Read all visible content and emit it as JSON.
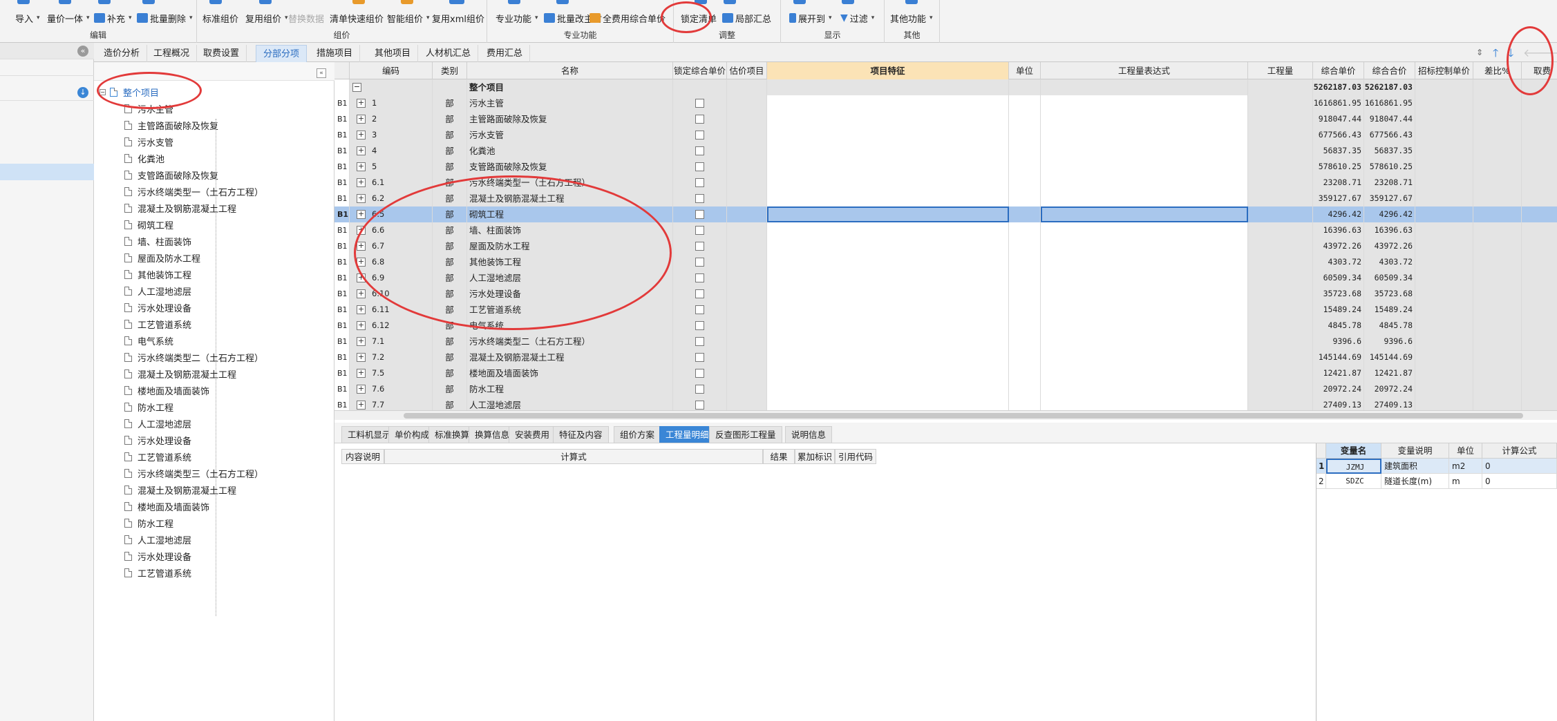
{
  "ribbon": {
    "groups": {
      "edit": "编辑",
      "pricing": "组价",
      "professional": "专业功能",
      "adjust": "调整",
      "display": "显示",
      "other": "其他"
    },
    "buttons": {
      "import": "导入",
      "price_integration": "量价一体",
      "supplement": "补充",
      "batch_delete": "批量删除",
      "standard_pricing": "标准组价",
      "reuse_pricing": "复用组价",
      "replace_data": "替换数据",
      "list_quick_pricing": "清单快速组价",
      "smart_pricing": "智能组价",
      "reuse_xml_pricing": "复用xml组价",
      "professional_func": "专业功能",
      "batch_change_material": "批量改主材",
      "full_cost_unit_price": "全费用综合单价",
      "lock_list": "锁定清单",
      "partial_summary": "局部汇总",
      "expand_to": "展开到",
      "filter": "过滤",
      "other_func": "其他功能"
    }
  },
  "tabs": [
    "造价分析",
    "工程概况",
    "取费设置",
    "分部分项",
    "措施项目",
    "其他项目",
    "人材机汇总",
    "费用汇总"
  ],
  "active_tab": "分部分项",
  "tree": {
    "root": "整个项目",
    "items": [
      "污水主管",
      "主管路面破除及恢复",
      "污水支管",
      "化粪池",
      "支管路面破除及恢复",
      "污水终端类型一（土石方工程）",
      "混凝土及钢筋混凝土工程",
      "砌筑工程",
      "墙、柱面装饰",
      "屋面及防水工程",
      "其他装饰工程",
      "人工湿地滤层",
      "污水处理设备",
      "工艺管道系统",
      "电气系统",
      "污水终端类型二（土石方工程）",
      "混凝土及钢筋混凝土工程",
      "楼地面及墙面装饰",
      "防水工程",
      "人工湿地滤层",
      "污水处理设备",
      "工艺管道系统",
      "污水终端类型三（土石方工程）",
      "混凝土及钢筋混凝土工程",
      "楼地面及墙面装饰",
      "防水工程",
      "人工湿地滤层",
      "污水处理设备",
      "工艺管道系统"
    ]
  },
  "grid": {
    "headers": {
      "code": "编码",
      "category": "类别",
      "name": "名称",
      "lock_unit_price": "锁定综合单价",
      "estimate_item": "估价项目",
      "item_feature": "项目特征",
      "unit": "单位",
      "quantity_expr": "工程量表达式",
      "quantity": "工程量",
      "unit_price": "综合单价",
      "total_price": "综合合价",
      "bid_control_price": "招标控制单价",
      "diff": "差比%",
      "fee": "取费"
    },
    "total_row": {
      "name": "整个项目",
      "unit_price": "5262187.03",
      "total_price": "5262187.03"
    },
    "rows": [
      {
        "rn": "B1",
        "code": "1",
        "cat": "部",
        "name": "污水主管",
        "up": "1616861.95",
        "tp": "1616861.95"
      },
      {
        "rn": "B1",
        "code": "2",
        "cat": "部",
        "name": "主管路面破除及恢复",
        "up": "918047.44",
        "tp": "918047.44"
      },
      {
        "rn": "B1",
        "code": "3",
        "cat": "部",
        "name": "污水支管",
        "up": "677566.43",
        "tp": "677566.43"
      },
      {
        "rn": "B1",
        "code": "4",
        "cat": "部",
        "name": "化粪池",
        "up": "56837.35",
        "tp": "56837.35"
      },
      {
        "rn": "B1",
        "code": "5",
        "cat": "部",
        "name": "支管路面破除及恢复",
        "up": "578610.25",
        "tp": "578610.25"
      },
      {
        "rn": "B1",
        "code": "6.1",
        "cat": "部",
        "name": "污水终端类型一（土石方工程）",
        "up": "23208.71",
        "tp": "23208.71"
      },
      {
        "rn": "B1",
        "code": "6.2",
        "cat": "部",
        "name": "混凝土及钢筋混凝土工程",
        "up": "359127.67",
        "tp": "359127.67"
      },
      {
        "rn": "B1",
        "code": "6.5",
        "cat": "部",
        "name": "砌筑工程",
        "up": "4296.42",
        "tp": "4296.42",
        "selected": true
      },
      {
        "rn": "B1",
        "code": "6.6",
        "cat": "部",
        "name": "墙、柱面装饰",
        "up": "16396.63",
        "tp": "16396.63"
      },
      {
        "rn": "B1",
        "code": "6.7",
        "cat": "部",
        "name": "屋面及防水工程",
        "up": "43972.26",
        "tp": "43972.26"
      },
      {
        "rn": "B1",
        "code": "6.8",
        "cat": "部",
        "name": "其他装饰工程",
        "up": "4303.72",
        "tp": "4303.72"
      },
      {
        "rn": "B1",
        "code": "6.9",
        "cat": "部",
        "name": "人工湿地滤层",
        "up": "60509.34",
        "tp": "60509.34"
      },
      {
        "rn": "B1",
        "code": "6.10",
        "cat": "部",
        "name": "污水处理设备",
        "up": "35723.68",
        "tp": "35723.68"
      },
      {
        "rn": "B1",
        "code": "6.11",
        "cat": "部",
        "name": "工艺管道系统",
        "up": "15489.24",
        "tp": "15489.24"
      },
      {
        "rn": "B1",
        "code": "6.12",
        "cat": "部",
        "name": "电气系统",
        "up": "4845.78",
        "tp": "4845.78"
      },
      {
        "rn": "B1",
        "code": "7.1",
        "cat": "部",
        "name": "污水终端类型二（土石方工程）",
        "up": "9396.6",
        "tp": "9396.6"
      },
      {
        "rn": "B1",
        "code": "7.2",
        "cat": "部",
        "name": "混凝土及钢筋混凝土工程",
        "up": "145144.69",
        "tp": "145144.69"
      },
      {
        "rn": "B1",
        "code": "7.5",
        "cat": "部",
        "name": "楼地面及墙面装饰",
        "up": "12421.87",
        "tp": "12421.87"
      },
      {
        "rn": "B1",
        "code": "7.6",
        "cat": "部",
        "name": "防水工程",
        "up": "20972.24",
        "tp": "20972.24"
      },
      {
        "rn": "B1",
        "code": "7.7",
        "cat": "部",
        "name": "人工湿地滤层",
        "up": "27409.13",
        "tp": "27409.13"
      }
    ]
  },
  "bottom_tabs": [
    "工料机显示",
    "单价构成",
    "标准换算",
    "换算信息",
    "安装费用",
    "特征及内容",
    "组价方案",
    "工程量明细",
    "反查图形工程量",
    "说明信息"
  ],
  "active_bottom_tab": "工程量明细",
  "detail_headers": [
    "内容说明",
    "计算式",
    "结果",
    "累加标识",
    "引用代码"
  ],
  "vars": {
    "headers": [
      "变量名",
      "变量说明",
      "单位",
      "计算公式"
    ],
    "rows": [
      {
        "n": "1",
        "name": "JZMJ",
        "desc": "建筑面积",
        "unit": "m2",
        "formula": "0"
      },
      {
        "n": "2",
        "name": "SDZC",
        "desc": "隧道长度(m)",
        "unit": "m",
        "formula": "0"
      }
    ]
  }
}
